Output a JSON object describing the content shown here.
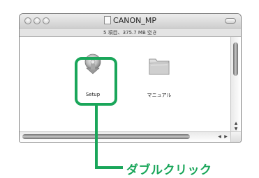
{
  "window": {
    "title": "CANON_MP",
    "status_text": "5 項目、375.7 MB 空き"
  },
  "files": [
    {
      "label": "Setup",
      "icon": "setup-installer-icon"
    },
    {
      "label": "マニュアル",
      "icon": "folder-icon"
    }
  ],
  "callout": {
    "text": "ダブルクリック",
    "color": "#1aa65a"
  }
}
